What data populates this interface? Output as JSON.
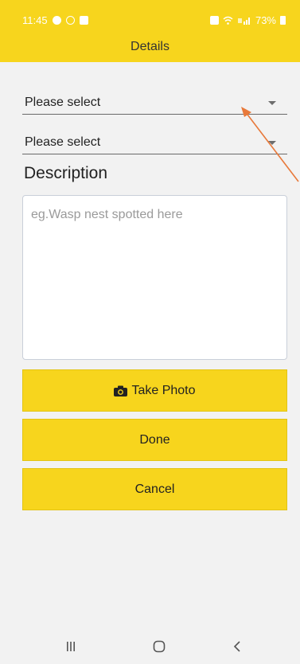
{
  "status_bar": {
    "time": "11:45",
    "battery": "73%"
  },
  "header": {
    "title": "Details"
  },
  "form": {
    "select1": {
      "value": "Please select"
    },
    "select2": {
      "value": "Please select"
    },
    "description_label": "Description",
    "description": {
      "value": "",
      "placeholder": "eg.Wasp nest spotted here"
    }
  },
  "buttons": {
    "take_photo": "Take Photo",
    "done": "Done",
    "cancel": "Cancel"
  },
  "colors": {
    "accent": "#f7d51d",
    "background": "#f2f2f2",
    "annotation_arrow": "#e8793a"
  },
  "icons": {
    "photo_button": "camera-icon",
    "nav_recent": "recent-apps-icon",
    "nav_home": "home-icon",
    "nav_back": "back-icon"
  }
}
